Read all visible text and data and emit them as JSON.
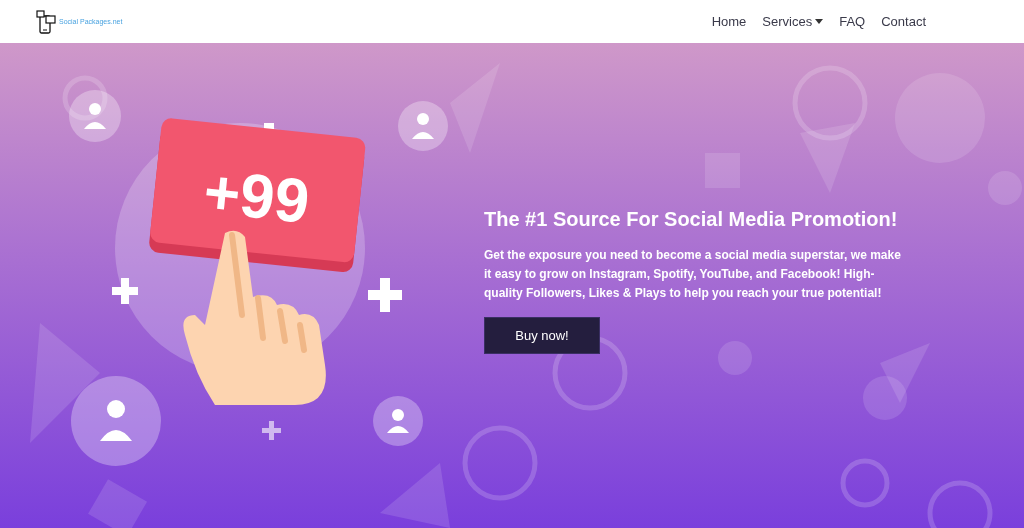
{
  "header": {
    "logo_text": "Social Packages.net",
    "nav": [
      {
        "label": "Home",
        "kind": "link"
      },
      {
        "label": "Services",
        "kind": "dropdown"
      },
      {
        "label": "FAQ",
        "kind": "link"
      },
      {
        "label": "Contact",
        "kind": "link"
      }
    ]
  },
  "hero": {
    "badge": "+99",
    "title": "The #1 Source For Social Media Promotion!",
    "text": "Get the exposure you need to become a social media superstar, we make it easy to grow on Instagram, Spotify, YouTube, and Facebook! High-quality Followers, Likes & Plays to help you reach your true potential!",
    "button": "Buy now!"
  }
}
